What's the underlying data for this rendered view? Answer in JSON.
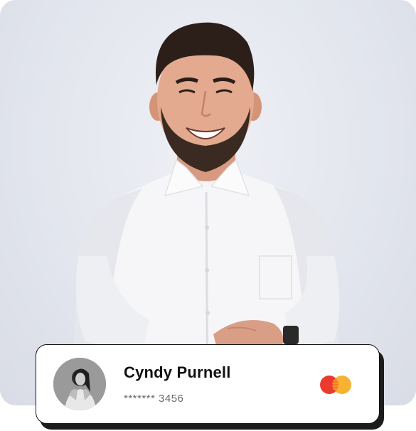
{
  "profile_card": {
    "name": "Cyndy Purnell",
    "masked_card_number": "******* 3456",
    "card_brand_icon": "mastercard-icon"
  },
  "colors": {
    "photo_background": "#e3e6ee",
    "card_background": "#ffffff",
    "card_border": "#141414",
    "mastercard_red": "#eb3b2f",
    "mastercard_yellow": "#f6b233"
  }
}
